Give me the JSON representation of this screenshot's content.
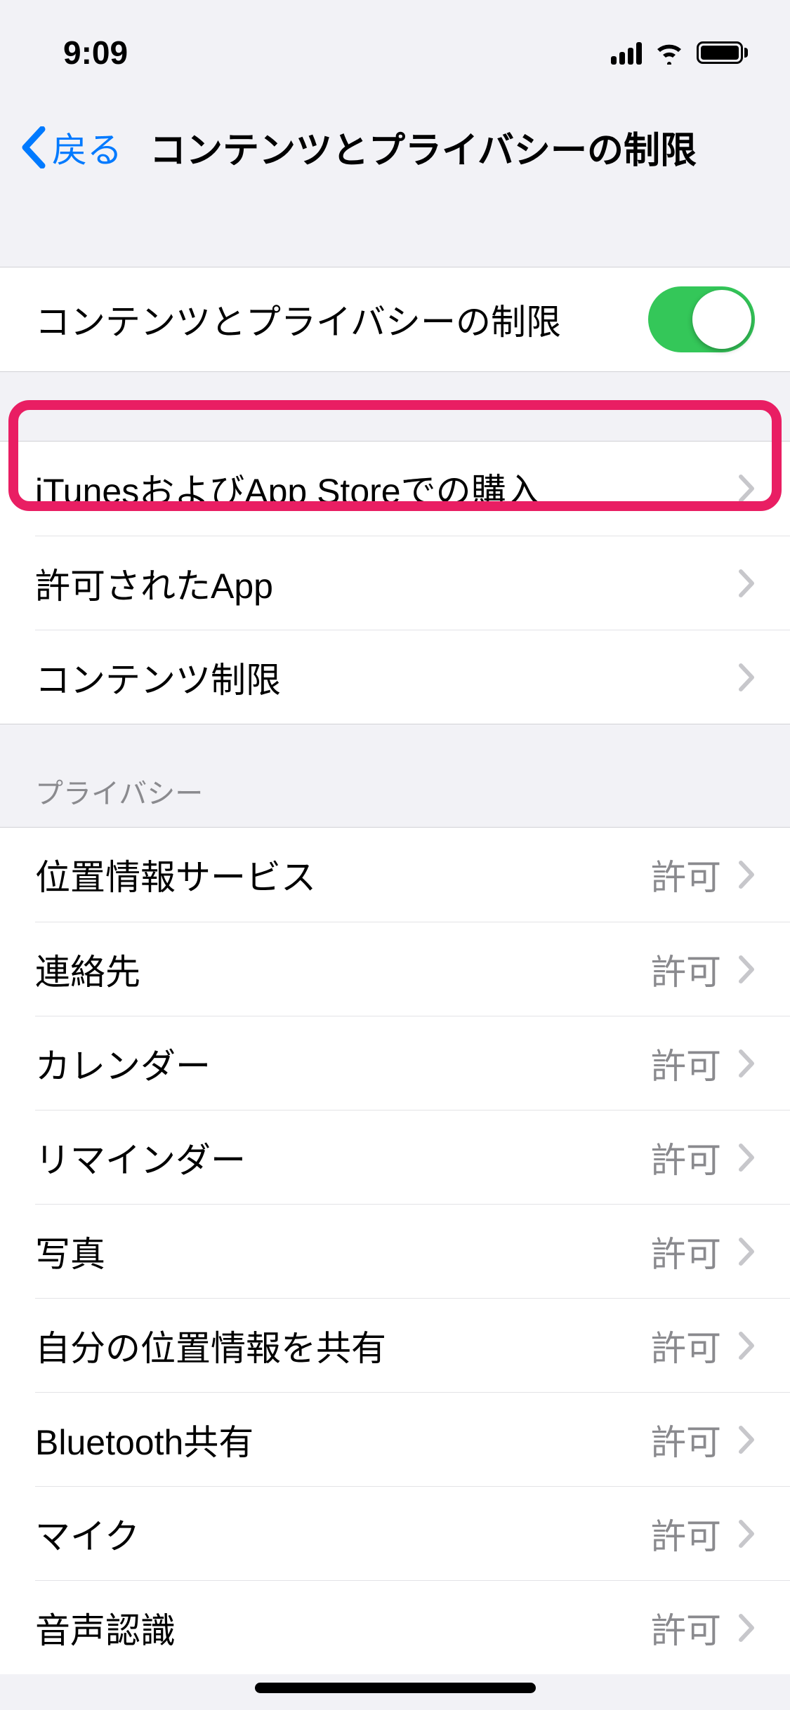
{
  "status": {
    "time": "9:09"
  },
  "nav": {
    "back": "戻る",
    "title": "コンテンツとプライバシーの制限"
  },
  "sections": {
    "toggle": {
      "label": "コンテンツとプライバシーの制限",
      "on": true
    },
    "group2": {
      "items": [
        {
          "label": "iTunesおよびApp Storeでの購入"
        },
        {
          "label": "許可されたApp"
        },
        {
          "label": "コンテンツ制限"
        }
      ]
    },
    "privacy": {
      "header": "プライバシー",
      "value_allow": "許可",
      "items": [
        {
          "label": "位置情報サービス",
          "value": "許可"
        },
        {
          "label": "連絡先",
          "value": "許可"
        },
        {
          "label": "カレンダー",
          "value": "許可"
        },
        {
          "label": "リマインダー",
          "value": "許可"
        },
        {
          "label": "写真",
          "value": "許可"
        },
        {
          "label": "自分の位置情報を共有",
          "value": "許可"
        },
        {
          "label": "Bluetooth共有",
          "value": "許可"
        },
        {
          "label": "マイク",
          "value": "許可"
        },
        {
          "label": "音声認識",
          "value": "許可"
        }
      ]
    }
  },
  "highlight": {
    "target": "itunes-purchases-cell"
  }
}
